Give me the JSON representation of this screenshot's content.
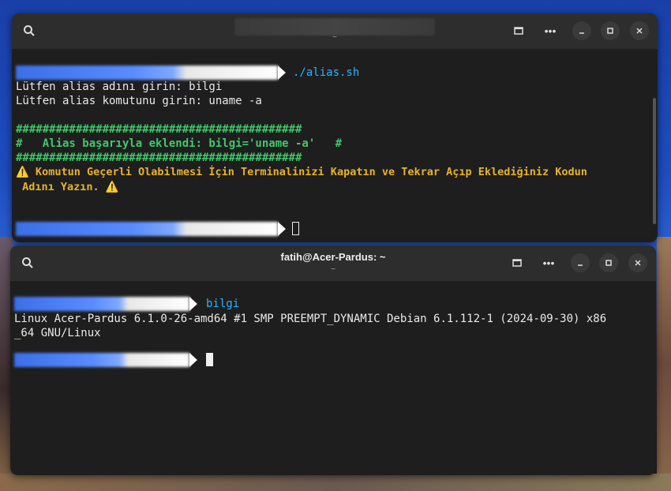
{
  "window1": {
    "title": "",
    "subtitle": "~",
    "command": "./alias.sh",
    "lines": [
      "Lütfen alias adını girin: bilgi",
      "Lütfen alias komutunu girin: uname -a"
    ],
    "hash_line": "###########################################",
    "success_line": "#   Alias başarıyla eklendi: bilgi='uname -a'   #",
    "warning_line1": "⚠️ Komutun Geçerli Olabilmesi İçin Terminalinizi Kapatın ve Tekrar Açıp Eklediğiniz Kodun",
    "warning_line2": " Adını Yazın. ⚠️"
  },
  "window2": {
    "title": "fatih@Acer-Pardus: ~",
    "subtitle": "~",
    "command": "bilgi",
    "output1": "Linux Acer-Pardus 6.1.0-26-amd64 #1 SMP PREEMPT_DYNAMIC Debian 6.1.112-1 (2024-09-30) x86",
    "output2": "_64 GNU/Linux"
  },
  "colors": {
    "command": "#2ab4ff",
    "success": "#3fc96a",
    "warning": "#e8b32a",
    "terminal_bg": "#1e1e1e",
    "titlebar_bg": "#2d2d2d"
  },
  "icons": [
    "search-icon",
    "new-tab-icon",
    "menu-dots-icon",
    "minimize-icon",
    "maximize-icon",
    "close-icon"
  ]
}
